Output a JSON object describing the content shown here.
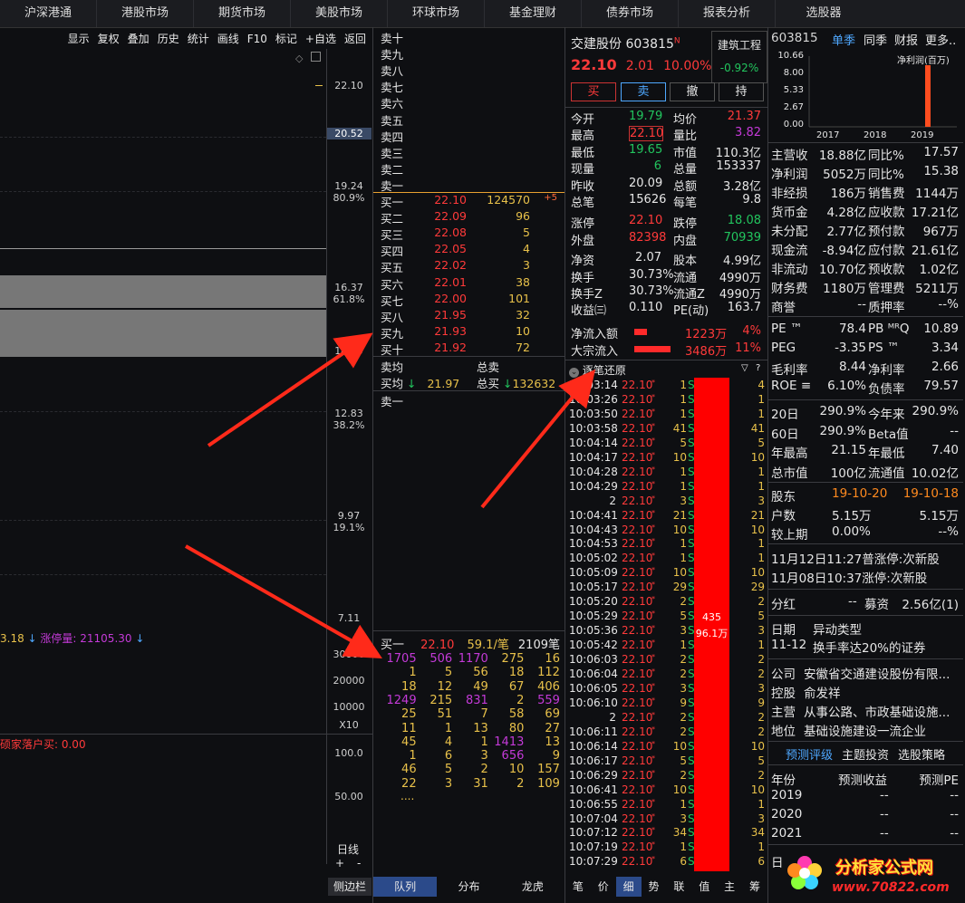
{
  "nav": [
    "沪深港通",
    "港股市场",
    "期货市场",
    "美股市场",
    "环球市场",
    "基金理财",
    "债券市场",
    "报表分析",
    "选股器"
  ],
  "ktoolbar": [
    "显示",
    "复权",
    "叠加",
    "历史",
    "统计",
    "画线",
    "F10",
    "标记",
    "+自选",
    "返回"
  ],
  "price_axis": [
    {
      "p": "22.10",
      "pct": ""
    },
    {
      "p": "20.52",
      "pct": ""
    },
    {
      "p": "19.24",
      "pct": "80.9%"
    },
    {
      "p": "16.37",
      "pct": "61.8%"
    },
    {
      "p": "14.50",
      "pct": ""
    },
    {
      "p": "12.83",
      "pct": "38.2%"
    },
    {
      "p": "9.97",
      "pct": "19.1%"
    },
    {
      "p": "7.11",
      "pct": ""
    }
  ],
  "volume_axis": [
    "30000",
    "20000",
    "10000",
    "X10"
  ],
  "lower_axis": [
    "100.0",
    "50.00"
  ],
  "chart_labels": {
    "vol_prefix": "3.18",
    "limit_vol": "涨停量: 21105.30",
    "fund": "硕家落户买: 0.00"
  },
  "chart_bottom": {
    "period": "日线",
    "plus": "+",
    "minus": "-",
    "side": "侧边栏"
  },
  "sell_labels": [
    "卖十",
    "卖九",
    "卖八",
    "卖七",
    "卖六",
    "卖五",
    "卖四",
    "卖三",
    "卖二",
    "卖一"
  ],
  "buy_levels": [
    {
      "l": "买一",
      "p": "22.10",
      "v": "124570",
      "d": "+5"
    },
    {
      "l": "买二",
      "p": "22.09",
      "v": "96",
      "d": ""
    },
    {
      "l": "买三",
      "p": "22.08",
      "v": "5",
      "d": ""
    },
    {
      "l": "买四",
      "p": "22.05",
      "v": "4",
      "d": ""
    },
    {
      "l": "买五",
      "p": "22.02",
      "v": "3",
      "d": ""
    },
    {
      "l": "买六",
      "p": "22.01",
      "v": "38",
      "d": ""
    },
    {
      "l": "买七",
      "p": "22.00",
      "v": "101",
      "d": ""
    },
    {
      "l": "买八",
      "p": "21.95",
      "v": "32",
      "d": ""
    },
    {
      "l": "买九",
      "p": "21.93",
      "v": "10",
      "d": ""
    },
    {
      "l": "买十",
      "p": "21.92",
      "v": "72",
      "d": ""
    }
  ],
  "avg": {
    "sell_avg": "卖均",
    "total_sell": "总卖",
    "buy_avg": "买均",
    "buy_avg_val": "21.97",
    "total_buy": "总买",
    "total_buy_val": "132632",
    "sell1": "卖一"
  },
  "queue_head": {
    "label": "买一",
    "price": "22.10",
    "per": "59.1/笔",
    "count": "2109笔"
  },
  "queue": [
    [
      "1705",
      "506",
      "1170",
      "275",
      "16"
    ],
    [
      "1",
      "5",
      "56",
      "18",
      "112"
    ],
    [
      "18",
      "12",
      "49",
      "67",
      "406"
    ],
    [
      "1249",
      "215",
      "831",
      "2",
      "559"
    ],
    [
      "25",
      "51",
      "7",
      "58",
      "69"
    ],
    [
      "11",
      "1",
      "13",
      "80",
      "27"
    ],
    [
      "45",
      "4",
      "1",
      "1413",
      "13"
    ],
    [
      "1",
      "6",
      "3",
      "656",
      "9"
    ],
    [
      "46",
      "5",
      "2",
      "10",
      "157"
    ],
    [
      "22",
      "3",
      "31",
      "2",
      "109"
    ]
  ],
  "queue_more": "....",
  "mid_tabs": [
    "队列",
    "分布",
    "龙虎"
  ],
  "stock": {
    "name": "交建股份",
    "code": "603815",
    "mark": "N",
    "price": "22.10",
    "chg": "2.01",
    "pct": "10.00%",
    "sector": "建筑工程",
    "sector_pct": "-0.92%"
  },
  "trade_buttons": [
    "买",
    "卖",
    "撤",
    "持"
  ],
  "quote": [
    [
      "今开",
      "19.79",
      "均价",
      "21.37"
    ],
    [
      "最高",
      "22.10",
      "量比",
      "3.82"
    ],
    [
      "最低",
      "19.65",
      "市值",
      "110.3亿"
    ],
    [
      "现量",
      "6",
      "总量",
      "153337"
    ],
    [
      "昨收",
      "20.09",
      "总额",
      "3.28亿"
    ],
    [
      "总笔",
      "15626",
      "每笔",
      "9.8"
    ],
    [
      "涨停",
      "22.10",
      "跌停",
      "18.08"
    ],
    [
      "外盘",
      "82398",
      "内盘",
      "70939"
    ],
    [
      "净资",
      "2.07",
      "股本",
      "4.99亿"
    ],
    [
      "换手",
      "30.73%",
      "流通",
      "4990万"
    ],
    [
      "换手Z",
      "30.73%",
      "流通Z",
      "4990万"
    ],
    [
      "收益㈢",
      "0.110",
      "PE(动)",
      "163.7"
    ]
  ],
  "flow": [
    {
      "l": "净流入额",
      "v": "1223万",
      "p": "4%"
    },
    {
      "l": "大宗流入",
      "v": "3486万",
      "p": "11%"
    }
  ],
  "ticks_title": "逐笔还原",
  "ticks": [
    [
      "10:03:14",
      "22.10",
      "1",
      "S",
      "4"
    ],
    [
      "10:03:26",
      "22.10",
      "1",
      "S",
      "1"
    ],
    [
      "10:03:50",
      "22.10",
      "1",
      "S",
      "1"
    ],
    [
      "10:03:58",
      "22.10",
      "41",
      "S",
      "41"
    ],
    [
      "10:04:14",
      "22.10",
      "5",
      "S",
      "5"
    ],
    [
      "10:04:17",
      "22.10",
      "10",
      "S",
      "10"
    ],
    [
      "10:04:28",
      "22.10",
      "1",
      "S",
      "1"
    ],
    [
      "10:04:29",
      "22.10",
      "1",
      "S",
      "1"
    ],
    [
      "2",
      "22.10",
      "3",
      "S",
      "3"
    ],
    [
      "10:04:41",
      "22.10",
      "21",
      "S",
      "21"
    ],
    [
      "10:04:43",
      "22.10",
      "10",
      "S",
      "10"
    ],
    [
      "10:04:53",
      "22.10",
      "1",
      "S",
      "1"
    ],
    [
      "10:05:02",
      "22.10",
      "1",
      "S",
      "1"
    ],
    [
      "10:05:09",
      "22.10",
      "10",
      "S",
      "10"
    ],
    [
      "10:05:17",
      "22.10",
      "29",
      "S",
      "29"
    ],
    [
      "10:05:20",
      "22.10",
      "2",
      "S",
      "2"
    ],
    [
      "10:05:29",
      "22.10",
      "5",
      "S",
      "5"
    ],
    [
      "10:05:36",
      "22.10",
      "3",
      "S",
      "3"
    ],
    [
      "10:05:42",
      "22.10",
      "1",
      "S",
      "1"
    ],
    [
      "10:06:03",
      "22.10",
      "2",
      "S",
      "2"
    ],
    [
      "10:06:04",
      "22.10",
      "2",
      "S",
      "2"
    ],
    [
      "10:06:05",
      "22.10",
      "3",
      "S",
      "3"
    ],
    [
      "10:06:10",
      "22.10",
      "9",
      "S",
      "9"
    ],
    [
      "2",
      "22.10",
      "2",
      "S",
      "2"
    ],
    [
      "10:06:11",
      "22.10",
      "2",
      "S",
      "2"
    ],
    [
      "10:06:14",
      "22.10",
      "10",
      "S",
      "10"
    ],
    [
      "10:06:17",
      "22.10",
      "5",
      "S",
      "5"
    ],
    [
      "10:06:29",
      "22.10",
      "2",
      "S",
      "2"
    ],
    [
      "10:06:41",
      "22.10",
      "10",
      "S",
      "10"
    ],
    [
      "10:06:55",
      "22.10",
      "1",
      "S",
      "1"
    ],
    [
      "10:07:04",
      "22.10",
      "3",
      "S",
      "3"
    ],
    [
      "10:07:12",
      "22.10",
      "34",
      "S",
      "34"
    ],
    [
      "10:07:19",
      "22.10",
      "1",
      "S",
      "1"
    ],
    [
      "10:07:29",
      "22.10",
      "6",
      "S",
      "6"
    ]
  ],
  "big_order": {
    "n": "435",
    "amt": "96.1万"
  },
  "tick_tabs": [
    "笔",
    "价",
    "细",
    "势",
    "联",
    "值",
    "主",
    "筹"
  ],
  "right": {
    "code": "603815",
    "tabs": [
      "单季",
      "同季",
      "财报",
      "更多.."
    ],
    "chart_y": [
      "10.66",
      "8.00",
      "5.33",
      "2.67",
      "0.00"
    ],
    "chart_x": [
      "2017",
      "2018",
      "2019"
    ],
    "chart_title": "净利润(百万)",
    "fin": [
      [
        "主营收",
        "18.88亿",
        "同比%",
        "17.57"
      ],
      [
        "净利润",
        "5052万",
        "同比%",
        "15.38"
      ],
      [
        "非经损",
        "186万",
        "销售费",
        "1144万"
      ],
      [
        "货币金",
        "4.28亿",
        "应收款",
        "17.21亿"
      ],
      [
        "未分配",
        "2.77亿",
        "预付款",
        "967万"
      ],
      [
        "现金流",
        "-8.94亿",
        "应付款",
        "21.61亿"
      ],
      [
        "非流动",
        "10.70亿",
        "预收款",
        "1.02亿"
      ],
      [
        "财务费",
        "1180万",
        "管理费",
        "5211万"
      ],
      [
        "商誉",
        "--",
        "质押率",
        "--%"
      ]
    ],
    "val": [
      [
        "PE ™",
        "78.4",
        "PB ᴹᴿQ",
        "10.89"
      ],
      [
        "PEG",
        "-3.35",
        "PS ™",
        "3.34"
      ],
      [
        "毛利率",
        "8.44",
        "净利率",
        "2.66"
      ],
      [
        "ROE ≡",
        "6.10%",
        "负债率",
        "79.57"
      ]
    ],
    "perf": [
      [
        "20日",
        "290.9%",
        "今年来",
        "290.9%"
      ],
      [
        "60日",
        "290.9%",
        "Beta值",
        "--"
      ],
      [
        "年最高",
        "21.15",
        "年最低",
        "7.40"
      ],
      [
        "总市值",
        "100亿",
        "流通值",
        "10.02亿"
      ]
    ],
    "holders": [
      [
        "股东",
        "19-10-20",
        "19-10-18"
      ],
      [
        "户数",
        "5.15万",
        "5.15万"
      ],
      [
        "较上期",
        "0.00%",
        "--%"
      ]
    ],
    "news": [
      "11月12日11:27普涨停:次新股",
      "11月08日10:37涨停:次新股"
    ],
    "div": {
      "l": "分红",
      "v": "--",
      "l2": "募资",
      "v2": "2.56亿(1)"
    },
    "event": {
      "h1": "日期",
      "h2": "异动类型",
      "d": "11-12",
      "t": "换手率达20%的证券"
    },
    "company": [
      [
        "公司",
        "安徽省交通建设股份有限..."
      ],
      [
        "控股",
        "俞发祥"
      ],
      [
        "主营",
        "从事公路、市政基础设施..."
      ],
      [
        "地位",
        "基础设施建设一流企业"
      ]
    ],
    "links": [
      "预测评级",
      "主题投资",
      "选股策略"
    ],
    "forecast_head": [
      "年份",
      "预测收益",
      "预测PE"
    ],
    "forecast": [
      [
        "2019",
        "--",
        "--"
      ],
      [
        "2020",
        "--",
        "--"
      ],
      [
        "2021",
        "--",
        "--"
      ]
    ],
    "date_label": "日"
  },
  "watermark": {
    "a": "分析家公式网",
    "b": "www.70822.com"
  }
}
